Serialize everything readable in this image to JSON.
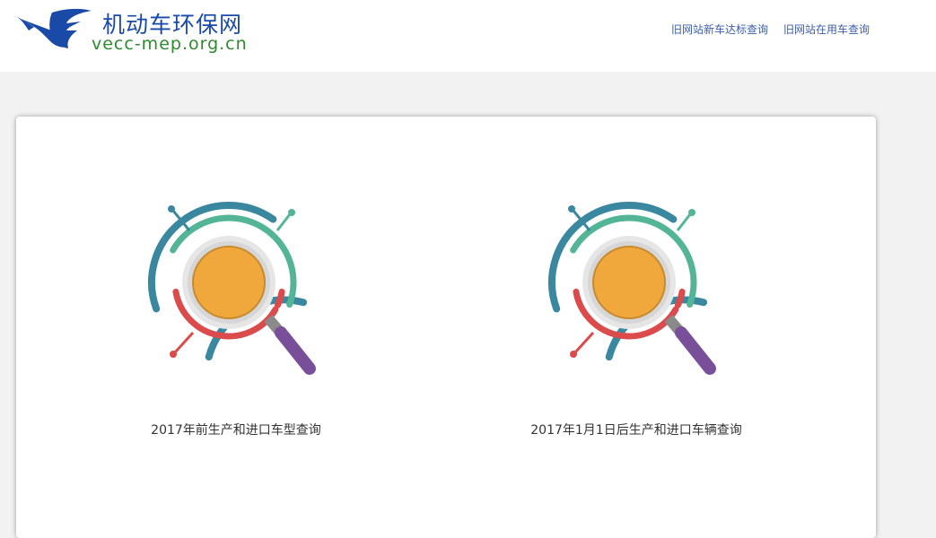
{
  "brand": {
    "title": "机动车环保网",
    "domain": "vecc-mep.org.cn",
    "colors": {
      "title": "#1a4aa8",
      "domain": "#2e8a2e",
      "mark": "#1a4aa8"
    }
  },
  "nav": {
    "links": [
      {
        "label": "旧网站新车达标查询"
      },
      {
        "label": "旧网站在用车查询"
      }
    ]
  },
  "main": {
    "options": [
      {
        "label": "2017年前生产和进口车型查询",
        "icon": "magnifier-search-icon"
      },
      {
        "label": "2017年1月1日后生产和进口车辆查询",
        "icon": "magnifier-search-icon"
      }
    ]
  },
  "icon_colors": {
    "blue": "#3a87a0",
    "green": "#54b596",
    "red": "#dc4b4b",
    "orange": "#f0a83c",
    "gray_ring": "#d6d6d6",
    "handle": "#7a4f9a"
  }
}
